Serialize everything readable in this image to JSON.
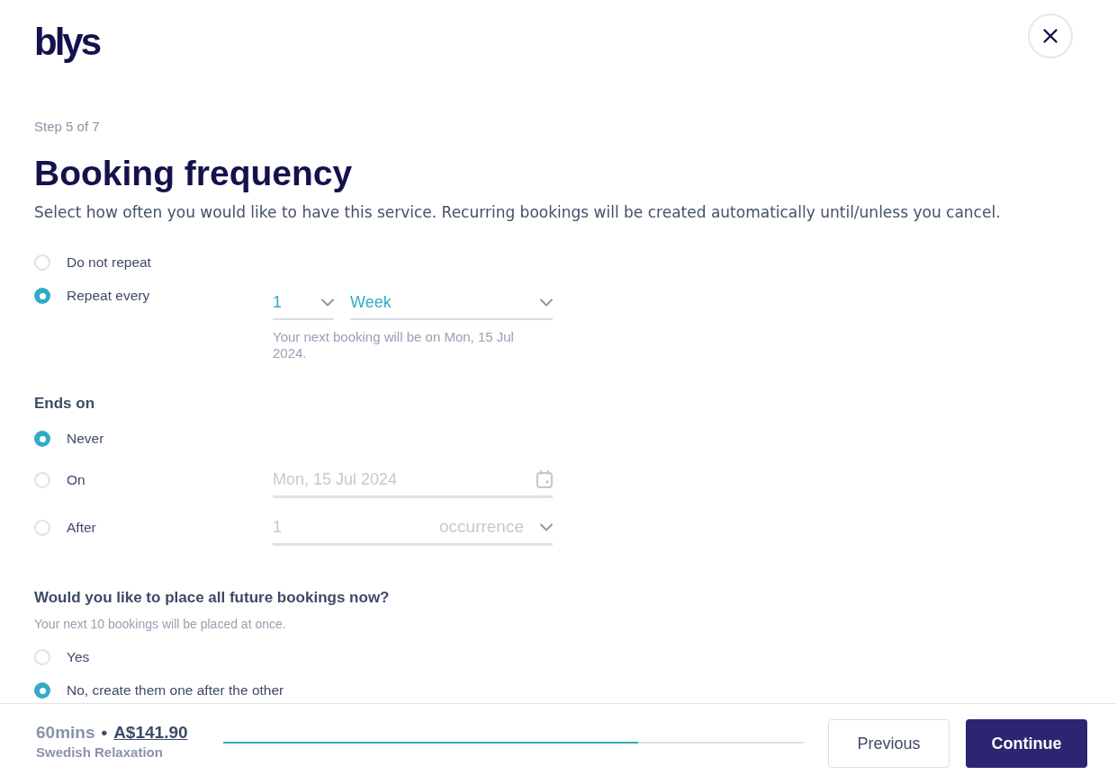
{
  "header": {
    "logo": "blys"
  },
  "step": "Step 5 of 7",
  "title": "Booking frequency",
  "description": "Select how often you would like to have this service. Recurring bookings will be created automatically until/unless you cancel.",
  "frequency_options": [
    {
      "kind": "plain",
      "label": "Do not repeat",
      "selected": false
    },
    {
      "kind": "interval",
      "label": "Repeat every",
      "selected": true
    }
  ],
  "repeat_interval": {
    "count": "1",
    "unit": "Week",
    "note": "Your next booking will be on Mon, 15 Jul 2024."
  },
  "ends_on": {
    "heading": "Ends on",
    "options": [
      {
        "kind": "plain",
        "label": "Never",
        "selected": true
      },
      {
        "kind": "date",
        "label": "On",
        "selected": false,
        "value": "Mon, 15 Jul 2024",
        "disabled": true
      },
      {
        "kind": "count",
        "label": "After",
        "selected": false,
        "value": "1",
        "unit": "occurrence",
        "disabled": true
      }
    ]
  },
  "future_bookings": {
    "question": "Would you like to place all future bookings now?",
    "note": "Your next 10 bookings will be placed at once.",
    "options": [
      {
        "label": "Yes",
        "selected": false
      },
      {
        "label": "No, create them one after the other",
        "selected": true
      }
    ]
  },
  "footer": {
    "duration": "60mins",
    "separator": "•",
    "price": "A$141.90",
    "service": "Swedish Relaxation",
    "progress": {
      "level": 0.714
    },
    "buttons": [
      {
        "kind": "secondary",
        "label": "Previous"
      },
      {
        "kind": "primary",
        "label": "Continue"
      }
    ]
  }
}
